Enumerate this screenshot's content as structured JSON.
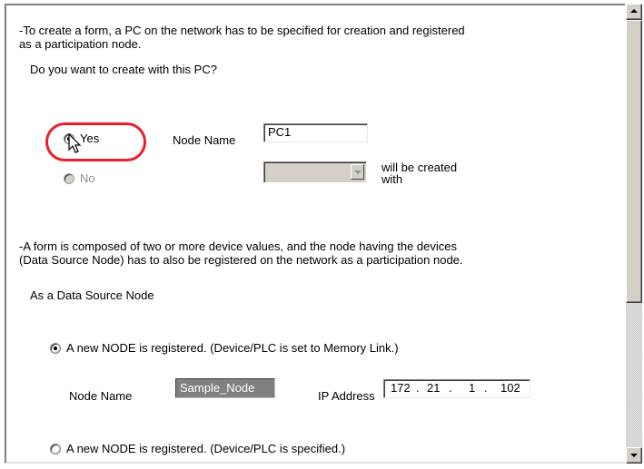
{
  "intro": {
    "line1": "-To create a form, a PC on the network has to be specified for creation and registered",
    "line2": "as a participation node.",
    "question": "Do you want to create with this PC?"
  },
  "create_choice": {
    "yes_label": "Yes",
    "yes_checked": true,
    "no_label": "No",
    "no_enabled": false,
    "node_name_label": "Node Name",
    "node_name_value": "PC1",
    "created_with_label_line1": "will be created",
    "created_with_label_line2": "with"
  },
  "data_source": {
    "line1": "-A form is composed of two or more device values, and the node having the devices",
    "line2": "(Data Source Node) has to also be registered on the network as a participation node.",
    "heading": "As a Data Source Node",
    "option1_label": "A new NODE is registered. (Device/PLC is set to Memory Link.)",
    "option1_checked": true,
    "node_name_label": "Node Name",
    "node_name_value": "Sample_Node",
    "ip_label": "IP Address",
    "ip_octets": [
      "172",
      "21",
      "1",
      "102"
    ],
    "option2_label": "A new NODE is registered. (Device/PLC is specified.)",
    "option2_checked": false
  },
  "colors": {
    "highlight_ring": "#e8202a",
    "disabled_text": "#909090",
    "chip_background": "#808080"
  },
  "icons": {
    "cursor": "arrow-pointer-icon"
  }
}
